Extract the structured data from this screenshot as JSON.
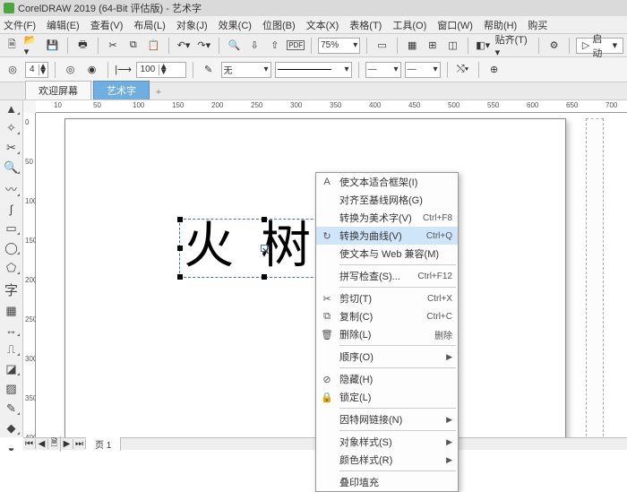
{
  "title": "CorelDRAW 2019 (64-Bit 评估版) - 艺术字",
  "menus": [
    "文件(F)",
    "编辑(E)",
    "查看(V)",
    "布局(L)",
    "对象(J)",
    "效果(C)",
    "位图(B)",
    "文本(X)",
    "表格(T)",
    "工具(O)",
    "窗口(W)",
    "帮助(H)",
    "购买"
  ],
  "toolbar": {
    "zoom": "75%",
    "snap": "贴齐(T)",
    "launch": "启动"
  },
  "optbar": {
    "rotate": "4",
    "width": "100",
    "outline": "无"
  },
  "tabs": {
    "welcome": "欢迎屏幕",
    "active": "艺术字"
  },
  "ruler_h": [
    "10",
    "50",
    "100",
    "150",
    "200",
    "250",
    "300",
    "350",
    "400",
    "450",
    "500",
    "550",
    "600",
    "650",
    "700"
  ],
  "ruler_v": [
    "0",
    "50",
    "100",
    "150",
    "200",
    "250",
    "300",
    "350",
    "400"
  ],
  "artistic_text": "火 树 钅",
  "context_menu": [
    {
      "type": "item",
      "icon": "A",
      "label": "使文本适合框架(I)",
      "shortcut": ""
    },
    {
      "type": "item",
      "icon": "",
      "label": "对齐至基线网格(G)",
      "shortcut": ""
    },
    {
      "type": "item",
      "icon": "",
      "label": "转换为美术字(V)",
      "shortcut": "Ctrl+F8"
    },
    {
      "type": "item",
      "icon": "↻",
      "label": "转换为曲线(V)",
      "shortcut": "Ctrl+Q",
      "highlight": true
    },
    {
      "type": "item",
      "icon": "",
      "label": "使文本与 Web 兼容(M)",
      "shortcut": ""
    },
    {
      "type": "sep"
    },
    {
      "type": "item",
      "icon": "",
      "label": "拼写检查(S)...",
      "shortcut": "Ctrl+F12"
    },
    {
      "type": "sep"
    },
    {
      "type": "item",
      "icon": "✂",
      "label": "剪切(T)",
      "shortcut": "Ctrl+X"
    },
    {
      "type": "item",
      "icon": "⧉",
      "label": "复制(C)",
      "shortcut": "Ctrl+C"
    },
    {
      "type": "item",
      "icon": "🗑",
      "label": "删除(L)",
      "shortcut": "删除"
    },
    {
      "type": "sep"
    },
    {
      "type": "item",
      "icon": "",
      "label": "顺序(O)",
      "shortcut": "",
      "submenu": true
    },
    {
      "type": "sep"
    },
    {
      "type": "item",
      "icon": "⊘",
      "label": "隐藏(H)",
      "shortcut": ""
    },
    {
      "type": "item",
      "icon": "🔒",
      "label": "锁定(L)",
      "shortcut": ""
    },
    {
      "type": "sep"
    },
    {
      "type": "item",
      "icon": "",
      "label": "因特网链接(N)",
      "shortcut": "",
      "submenu": true
    },
    {
      "type": "sep"
    },
    {
      "type": "item",
      "icon": "",
      "label": "对象样式(S)",
      "shortcut": "",
      "submenu": true
    },
    {
      "type": "item",
      "icon": "",
      "label": "颜色样式(R)",
      "shortcut": "",
      "submenu": true
    },
    {
      "type": "sep"
    },
    {
      "type": "item",
      "icon": "",
      "label": "叠印埴充",
      "shortcut": ""
    }
  ],
  "pager": {
    "page1": "页 1"
  },
  "tools": [
    "pick",
    "shape",
    "crop",
    "zoom",
    "freehand",
    "smartfill",
    "rect",
    "ellipse",
    "polygon",
    "text",
    "table",
    "dim",
    "connector",
    "dropshadow",
    "transparency",
    "eyedropper",
    "outline",
    "fill",
    "interactive"
  ]
}
